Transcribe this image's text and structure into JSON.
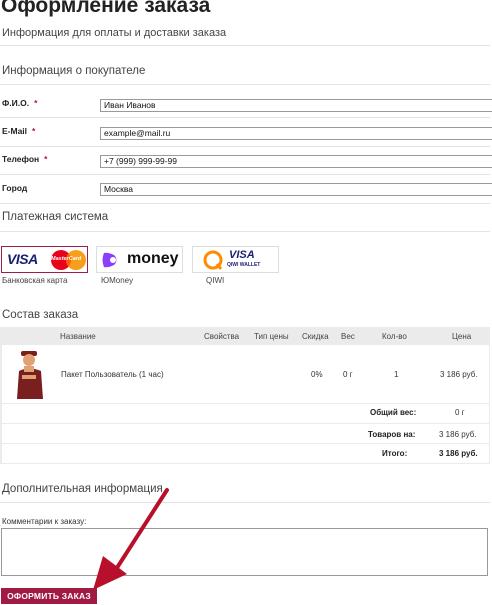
{
  "page": {
    "title": "Оформление заказа",
    "subtitle": "Информация для оплаты и доставки заказа"
  },
  "buyer": {
    "section_title": "Информация о покупателе",
    "fields": [
      {
        "label": "Ф.И.О.",
        "value": "Иван Иванов",
        "required": "*"
      },
      {
        "label": "E-Mail",
        "value": "example@mail.ru",
        "required": "*"
      },
      {
        "label": "Телефон",
        "value": "+7 (999) 999-99-99",
        "required": "*"
      },
      {
        "label": "Город",
        "value": "Москва"
      }
    ]
  },
  "payment": {
    "section_title": "Платежная система",
    "options": [
      {
        "label": "Банковская карта",
        "selected": true,
        "logo_text_1": "VISA",
        "logo_text_2": "MasterCard"
      },
      {
        "label": "ЮMoney",
        "selected": false,
        "logo_text_1": "money"
      },
      {
        "label": "QIWI",
        "selected": false,
        "logo_text_1": "VISA",
        "logo_text_2": "QIWI WALLET"
      }
    ]
  },
  "cart": {
    "section_title": "Состав заказа",
    "columns": [
      "Название",
      "Свойства",
      "Тип цены",
      "Скидка",
      "Вес",
      "Кол-во",
      "Цена"
    ],
    "items": [
      {
        "name": "Пакет Пользователь (1 час)",
        "props": "",
        "price_type": "",
        "discount": "0%",
        "weight": "0 г",
        "qty": "1",
        "price": "3 186 руб."
      }
    ],
    "totals": [
      {
        "label": "Общий вес:",
        "value": "0 г",
        "bold_value": false
      },
      {
        "label": "Товаров на:",
        "value": "3 186 руб.",
        "bold_value": false
      },
      {
        "label": "Итого:",
        "value": "3 186 руб.",
        "bold_value": true
      }
    ]
  },
  "extra": {
    "section_title": "Дополнительная информация",
    "comment_label": "Комментарии к заказу:",
    "comment_value": ""
  },
  "submit_label": "ОФОРМИТЬ ЗАКАЗ",
  "colors": {
    "accent": "#a11a43",
    "arrow": "#b8102a",
    "required": "#b0153a"
  }
}
